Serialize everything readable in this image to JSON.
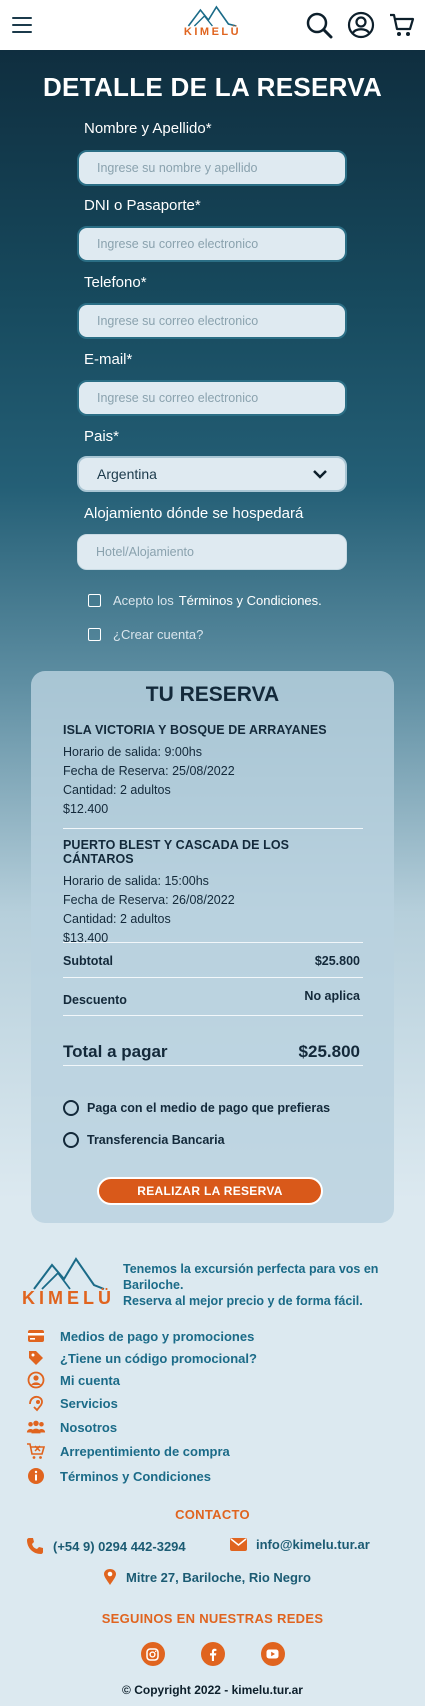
{
  "header": {
    "logo_text": "KIMELÜ"
  },
  "form": {
    "title": "DETALLE DE LA RESERVA",
    "fields": [
      {
        "label": "Nombre y Apellido*",
        "placeholder": "Ingrese su nombre y apellido"
      },
      {
        "label": "DNI o Pasaporte*",
        "placeholder": "Ingrese su correo electronico"
      },
      {
        "label": "Telefono*",
        "placeholder": "Ingrese su correo electronico"
      },
      {
        "label": "E-mail*",
        "placeholder": "Ingrese su correo electronico"
      },
      {
        "label": "Pais*",
        "value": "Argentina"
      },
      {
        "label": "Alojamiento dónde se hospedará",
        "placeholder": "Hotel/Alojamiento"
      }
    ],
    "terms_prefix": "Acepto los",
    "terms_link": "Términos y Condiciones.",
    "create_account": "¿Crear cuenta?"
  },
  "reservation": {
    "title": "TU RESERVA",
    "trips": [
      {
        "name": "ISLA VICTORIA Y BOSQUE DE ARRAYANES",
        "departure": "Horario de salida: 9:00hs",
        "date": "Fecha de Reserva: 25/08/2022",
        "quantity": "Cantidad: 2 adultos",
        "price": "$12.400"
      },
      {
        "name": "PUERTO BLEST Y CASCADA DE LOS CÁNTAROS",
        "departure": "Horario de salida: 15:00hs",
        "date": "Fecha de Reserva: 26/08/2022",
        "quantity": "Cantidad: 2 adultos",
        "price": "$13.400"
      }
    ],
    "subtotal_label": "Subtotal",
    "subtotal_value": "$25.800",
    "discount_label": "Descuento",
    "discount_value": "No aplica",
    "total_label": "Total a pagar",
    "total_value": "$25.800",
    "payment_options": [
      "Paga con el medio de pago que prefieras",
      "Transferencia Bancaria"
    ],
    "submit_label": "REALIZAR LA RESERVA"
  },
  "footer": {
    "logo_text": "KIMELÜ",
    "tagline_1": "Tenemos la excursión perfecta para vos en Bariloche.",
    "tagline_2": "Reserva al mejor precio y de forma fácil.",
    "menu": [
      {
        "label": "Medios de pago y promociones",
        "icon": "credit-card-icon"
      },
      {
        "label": "¿Tiene un código promocional?",
        "icon": "tag-icon"
      },
      {
        "label": "Mi cuenta",
        "icon": "user-icon"
      },
      {
        "label": "Servicios",
        "icon": "hand-icon"
      },
      {
        "label": "Nosotros",
        "icon": "users-icon"
      },
      {
        "label": "Arrepentimiento de compra",
        "icon": "cart-x-icon"
      },
      {
        "label": "Términos y Condiciones",
        "icon": "info-icon"
      }
    ],
    "contact_title": "CONTACTO",
    "phone": "(+54 9) 0294 442-3294",
    "email": "info@kimelu.tur.ar",
    "address": "Mitre 27, Bariloche, Rio Negro",
    "social_title": "SEGUINOS EN NUESTRAS REDES",
    "social_icons": [
      "instagram-icon",
      "facebook-icon",
      "youtube-icon"
    ],
    "copyright": "© Copyright 2022 - kimelu.tur.ar"
  },
  "colors": {
    "accent": "#e0641f",
    "dark": "#0f2e3f",
    "link": "#1b6b88"
  }
}
